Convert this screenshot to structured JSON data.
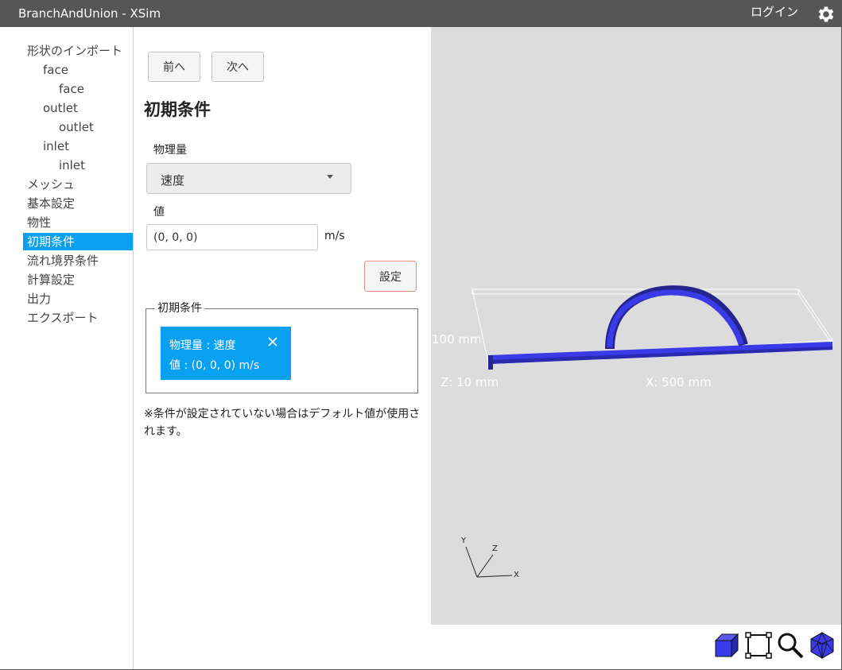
{
  "app": {
    "title": "BranchAndUnion - XSim",
    "login_label": "ログイン"
  },
  "sidebar": {
    "items": [
      {
        "label": "形状のインポート",
        "level": 0
      },
      {
        "label": "face",
        "level": 1
      },
      {
        "label": "face",
        "level": 2
      },
      {
        "label": "outlet",
        "level": 1
      },
      {
        "label": "outlet",
        "level": 2
      },
      {
        "label": "inlet",
        "level": 1
      },
      {
        "label": "inlet",
        "level": 2
      },
      {
        "label": "メッシュ",
        "level": 0
      },
      {
        "label": "基本設定",
        "level": 0
      },
      {
        "label": "物性",
        "level": 0
      },
      {
        "label": "初期条件",
        "level": 0,
        "active": true
      },
      {
        "label": "流れ境界条件",
        "level": 0
      },
      {
        "label": "計算設定",
        "level": 0
      },
      {
        "label": "出力",
        "level": 0
      },
      {
        "label": "エクスポート",
        "level": 0
      }
    ]
  },
  "panel": {
    "prev_label": "前へ",
    "next_label": "次へ",
    "title": "初期条件",
    "quantity_label": "物理量",
    "quantity_value": "速度",
    "value_label": "値",
    "value_input": "(0, 0, 0)",
    "unit": "m/s",
    "set_label": "設定",
    "conditions_legend": "初期条件",
    "condition": {
      "line1": "物理量 : 速度",
      "line2": "値 : (0, 0, 0) m/s"
    },
    "note": "※条件が設定されていない場合はデフォルト値が使用されます。"
  },
  "viewport": {
    "dim_y": "100 mm",
    "dim_z": "Z: 10 mm",
    "dim_x": "X: 500 mm",
    "axis_y": "Y",
    "axis_z": "Z",
    "axis_x": "X",
    "model_color": "#3a3ae8"
  },
  "toolbar": {
    "icons": [
      "view-cube-icon",
      "fit-frame-icon",
      "zoom-icon",
      "perspective-icon"
    ]
  },
  "colors": {
    "accent": "#0aa0f0",
    "titlebar": "#565656",
    "viewport_bg": "#dcdcdc"
  }
}
